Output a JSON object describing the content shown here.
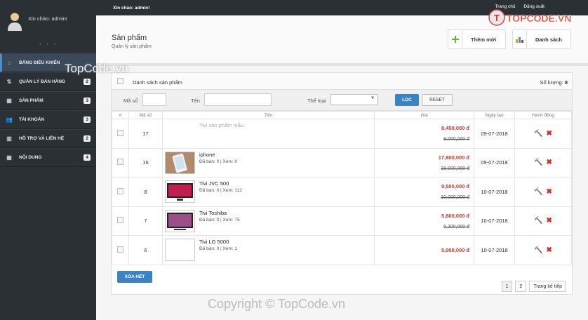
{
  "sidebar": {
    "welcome": "Xin chào: admin!",
    "dots": "• • •",
    "items": [
      {
        "label": "Bảng điều khiển",
        "icon": "home-icon",
        "badge": ""
      },
      {
        "label": "Quản lý bán hàng",
        "icon": "sort-icon",
        "badge": "2"
      },
      {
        "label": "Sản phẩm",
        "icon": "grid-icon",
        "badge": "3"
      },
      {
        "label": "Tài khoản",
        "icon": "users-icon",
        "badge": "3"
      },
      {
        "label": "Hỗ trợ và liên hệ",
        "icon": "columns-icon",
        "badge": "2"
      },
      {
        "label": "Nội dung",
        "icon": "grid-icon",
        "badge": "4"
      }
    ]
  },
  "topbar": {
    "hello": "Xin chào: admin!",
    "home": "Trang chủ",
    "logout": "Đăng xuất"
  },
  "header": {
    "title": "Sản phẩm",
    "subtitle": "Quản lý sản phẩm",
    "add_label": "Thêm mới",
    "list_label": "Danh sách"
  },
  "watermark": {
    "logo": "TOPCODE.VN",
    "mid": "TopCode.vn",
    "copyright": "Copyright © TopCode.vn"
  },
  "panel": {
    "title": "Danh sách sản phẩm",
    "qty_label": "Số lượng:",
    "qty_value": "8",
    "filter": {
      "ma_so": "Mã số",
      "ten": "Tên",
      "the_loai": "Thể loại",
      "loc": "LỌC",
      "reset": "RESET"
    },
    "columns": [
      "#",
      "Mã số",
      "Tên",
      "Giá",
      "Ngày tạo",
      "Hành động"
    ],
    "rows": [
      {
        "id": "17",
        "name": "Tivi sản phẩm mẫu",
        "meta": "",
        "price": "8,450,000 đ",
        "old": "9,000,000 đ",
        "date": "09-07-2018",
        "thumb": "none"
      },
      {
        "id": "16",
        "name": "iphone",
        "meta": "Đã bán: 0 | Xem: 0",
        "price": "17,800,000 đ",
        "old": "18,000,000 đ",
        "date": "09-07-2018",
        "thumb": "phone"
      },
      {
        "id": "8",
        "name": "Tivi JVC 500",
        "meta": "Đã bán: 0 | Xem: 112",
        "price": "9,500,000 đ",
        "old": "10,000,000 đ",
        "date": "10-07-2018",
        "thumb": "tv"
      },
      {
        "id": "7",
        "name": "Tivi Toshiba",
        "meta": "Đã bán: 0 | Xem: 75",
        "price": "5,800,000 đ",
        "old": "6,200,000 đ",
        "date": "10-07-2018",
        "thumb": "tv2"
      },
      {
        "id": "6",
        "name": "Tivi LG 5000",
        "meta": "Đã bán: 0 | Xem: 1",
        "price": "5,000,000 đ",
        "old": "",
        "date": "10-07-2018",
        "thumb": "empty"
      }
    ],
    "delete_all": "XÓA HẾT",
    "pages": [
      "1",
      "2"
    ],
    "next": "Trang kế tiếp"
  }
}
